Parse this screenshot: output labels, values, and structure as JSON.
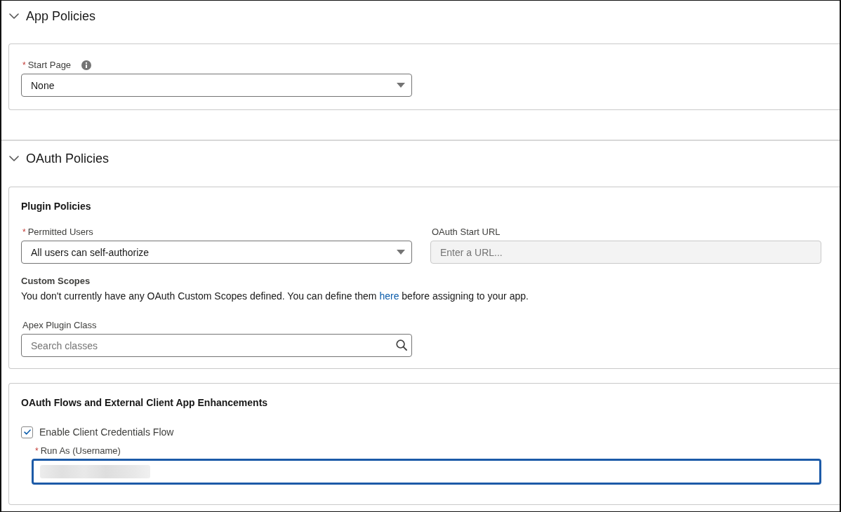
{
  "sections": [
    {
      "title": "App Policies",
      "expanded": true,
      "cards": [
        {
          "rows": [
            [
              {
                "kind": "select",
                "label": "Start Page",
                "required_marker": "*",
                "info": true,
                "value": "None",
                "disabled": false,
                "focused": false
              }
            ]
          ]
        }
      ]
    },
    {
      "title": "OAuth Policies",
      "expanded": true,
      "cards": [
        {
          "heading": "Plugin Policies",
          "rows": [
            [
              {
                "kind": "select",
                "label": "Permitted Users",
                "required_marker": "*",
                "value": "All users can self-authorize",
                "disabled": false,
                "focused": false
              },
              {
                "kind": "text",
                "label": "OAuth Start URL",
                "placeholder": "Enter a URL...",
                "disabled": true,
                "focused": false
              }
            ],
            [
              {
                "kind": "notice",
                "heading": "Custom Scopes",
                "text_before": "You don't currently have any OAuth Custom Scopes defined. You can define them",
                "link": "here",
                "text_after": "before assigning to your app."
              }
            ],
            [
              {
                "kind": "lookup",
                "label": "Apex Plugin Class",
                "placeholder": "Search classes",
                "disabled": false,
                "focused": false
              }
            ]
          ]
        },
        {
          "heading": "OAuth Flows and External Client App Enhancements",
          "rows": [
            [
              {
                "kind": "checkbox",
                "label": "Enable Client Credentials Flow",
                "checked": true,
                "children": [
                  {
                    "kind": "text",
                    "label": "Run As (Username)",
                    "required_marker": "*",
                    "disabled": false,
                    "focused": true,
                    "redacted": true
                  }
                ]
              }
            ]
          ]
        }
      ]
    }
  ]
}
